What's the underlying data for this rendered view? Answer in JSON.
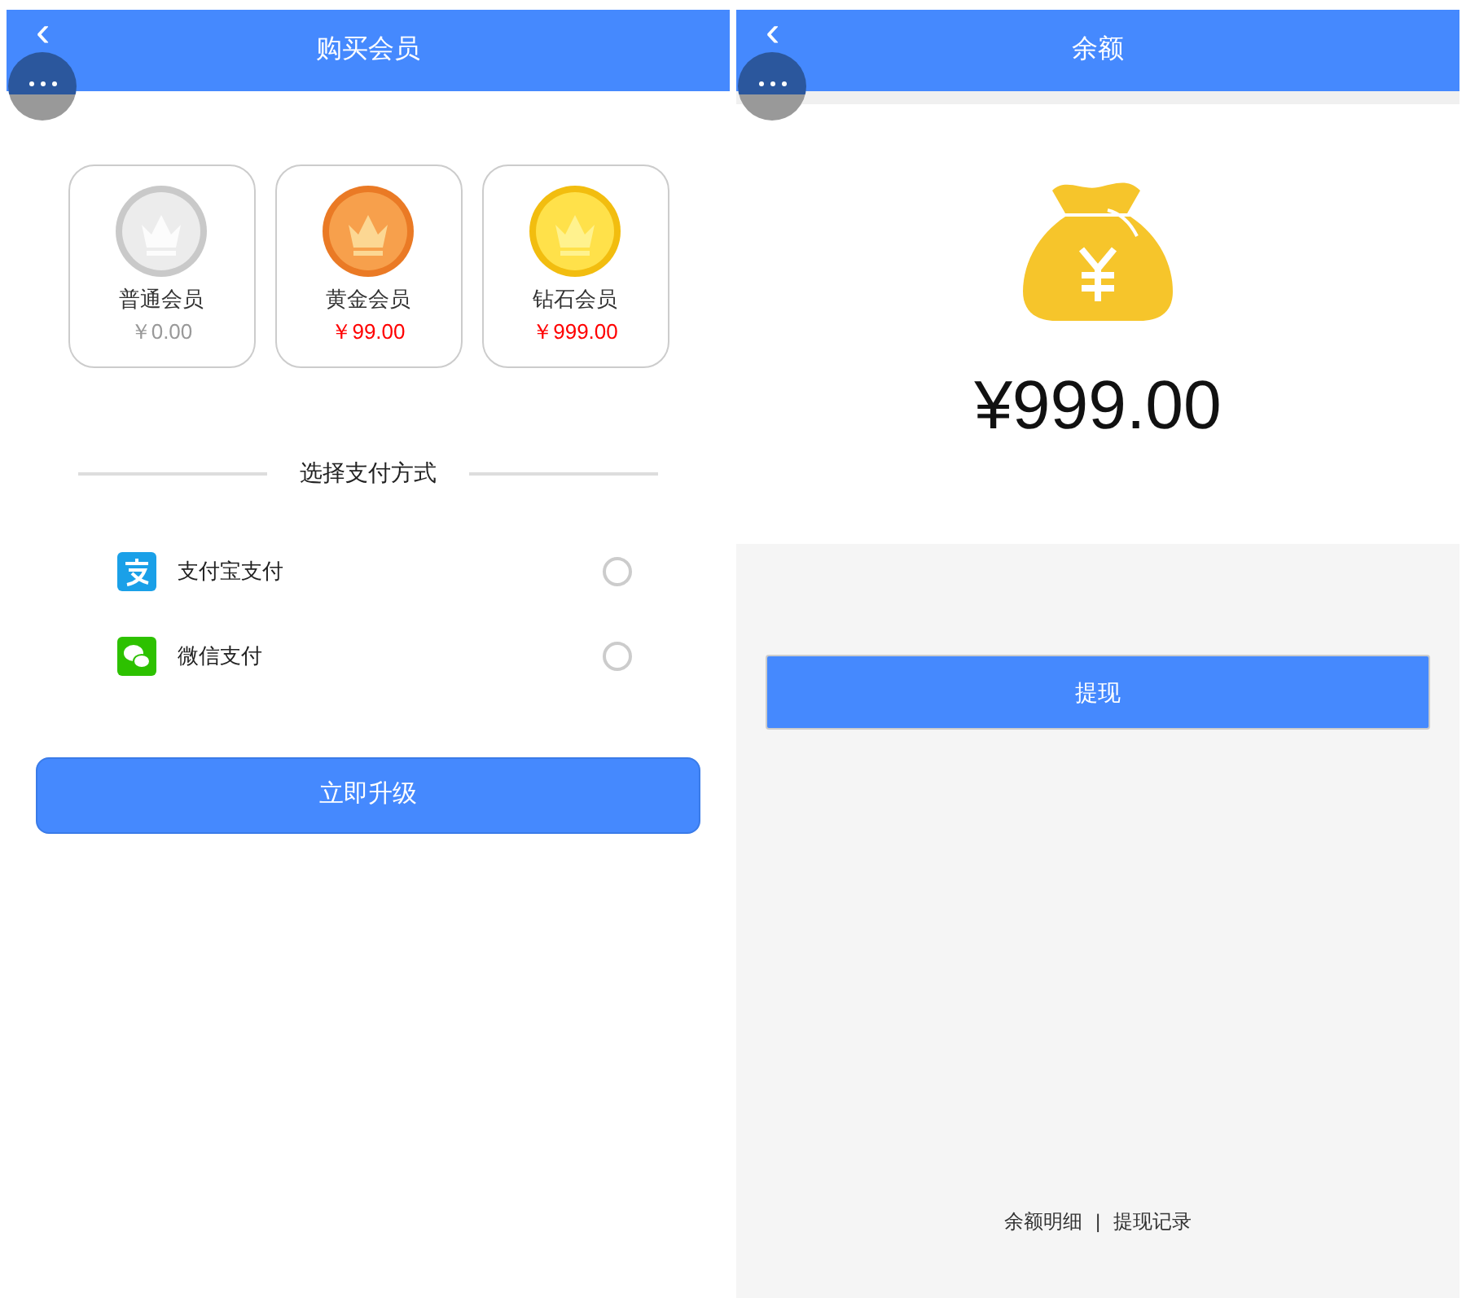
{
  "left_screen": {
    "title": "购买会员",
    "back": "‹",
    "tiers": [
      {
        "name": "普通会员",
        "price": "￥0.00",
        "kind": "silver",
        "selected": false
      },
      {
        "name": "黄金会员",
        "price": "￥99.00",
        "kind": "bronze",
        "selected": false
      },
      {
        "name": "钻石会员",
        "price": "￥999.00",
        "kind": "gold",
        "selected": false
      }
    ],
    "section_title": "选择支付方式",
    "payments": [
      {
        "label": "支付宝支付",
        "kind": "alipay",
        "selected": false
      },
      {
        "label": "微信支付",
        "kind": "wechat",
        "selected": false
      }
    ],
    "button": "立即升级"
  },
  "right_screen": {
    "title": "余额",
    "back": "‹",
    "balance": "¥999.00",
    "button": "提现",
    "links": [
      {
        "label": "余额明细"
      },
      {
        "label": "提现记录"
      }
    ],
    "separator": "|"
  }
}
